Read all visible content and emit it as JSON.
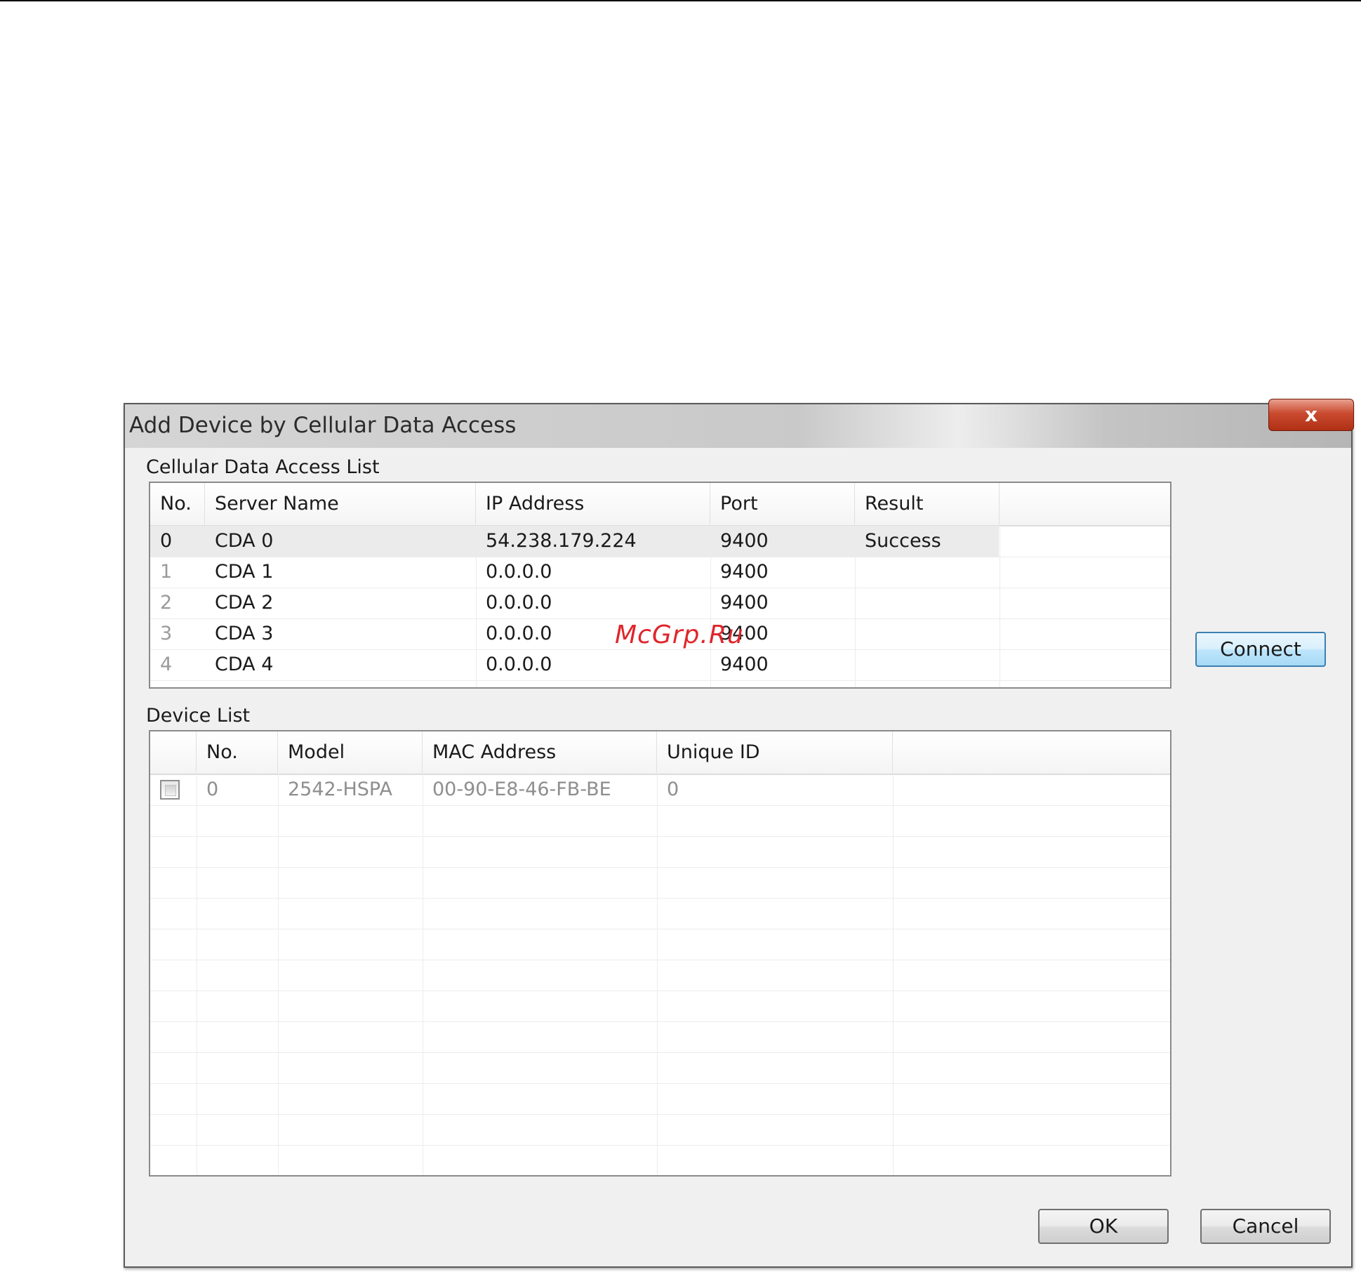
{
  "dialog": {
    "title": "Add Device by Cellular Data Access",
    "close_label": "x"
  },
  "cda_list": {
    "label": "Cellular Data Access List",
    "columns": [
      "No.",
      "Server Name",
      "IP Address",
      "Port",
      "Result"
    ],
    "rows": [
      {
        "no": "0",
        "server_name": "CDA 0",
        "ip": "54.238.179.224",
        "port": "9400",
        "result": "Success"
      },
      {
        "no": "1",
        "server_name": "CDA 1",
        "ip": "0.0.0.0",
        "port": "9400",
        "result": ""
      },
      {
        "no": "2",
        "server_name": "CDA 2",
        "ip": "0.0.0.0",
        "port": "9400",
        "result": ""
      },
      {
        "no": "3",
        "server_name": "CDA 3",
        "ip": "0.0.0.0",
        "port": "9400",
        "result": ""
      },
      {
        "no": "4",
        "server_name": "CDA 4",
        "ip": "0.0.0.0",
        "port": "9400",
        "result": ""
      }
    ]
  },
  "connect_label": "Connect",
  "device_list": {
    "label": "Device List",
    "columns": [
      "",
      "No.",
      "Model",
      "MAC Address",
      "Unique ID"
    ],
    "rows": [
      {
        "checked": false,
        "no": "0",
        "model": "2542-HSPA",
        "mac": "00-90-E8-46-FB-BE",
        "unique_id": "0"
      }
    ]
  },
  "buttons": {
    "ok": "OK",
    "cancel": "Cancel"
  },
  "watermark": "McGrp.Ru",
  "colors": {
    "selected_row": "#ebebeb",
    "focused_button_border": "#3c7fb1",
    "close_button": "#c94a2f",
    "watermark": "#e0252b"
  }
}
